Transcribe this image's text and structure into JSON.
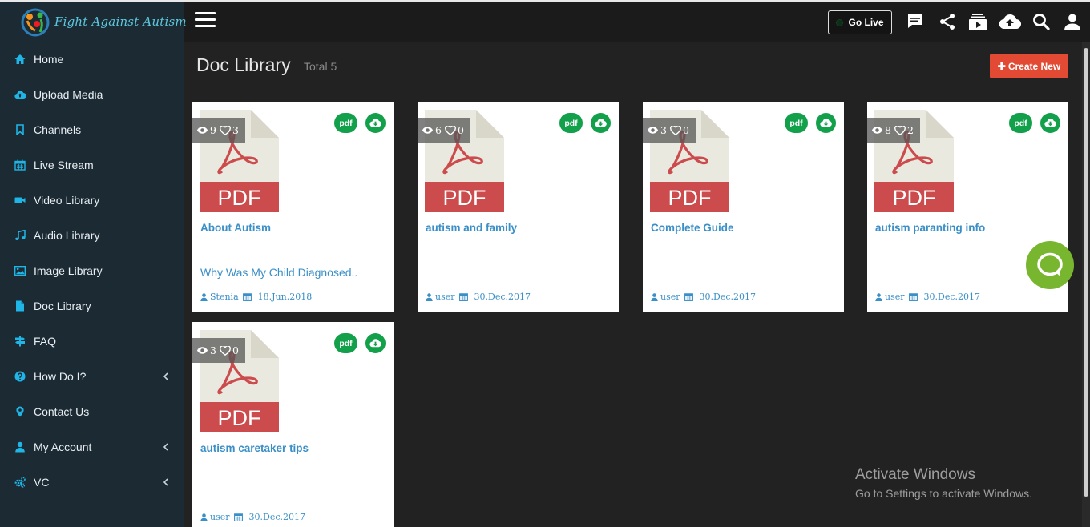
{
  "brand": {
    "name": "Fight Against Autism",
    "logo_icon": "autism-figures-logo"
  },
  "header": {
    "go_live_label": "Go Live",
    "icons": [
      "chat-icon",
      "share-icon",
      "playlist-icon",
      "upload-cloud-icon",
      "search-icon",
      "user-icon"
    ]
  },
  "sidebar": {
    "items": [
      {
        "label": "Home",
        "icon": "home-icon",
        "has_submenu": false
      },
      {
        "label": "Upload Media",
        "icon": "upload-cloud-icon",
        "has_submenu": false
      },
      {
        "label": "Channels",
        "icon": "bookmark-icon",
        "has_submenu": false
      },
      {
        "label": "Live Stream",
        "icon": "calendar-icon",
        "has_submenu": false
      },
      {
        "label": "Video Library",
        "icon": "video-camera-icon",
        "has_submenu": false
      },
      {
        "label": "Audio Library",
        "icon": "music-icon",
        "has_submenu": false
      },
      {
        "label": "Image Library",
        "icon": "image-icon",
        "has_submenu": false
      },
      {
        "label": "Doc Library",
        "icon": "file-icon",
        "has_submenu": false
      },
      {
        "label": "FAQ",
        "icon": "signpost-icon",
        "has_submenu": false
      },
      {
        "label": "How Do I?",
        "icon": "question-circle-icon",
        "has_submenu": true
      },
      {
        "label": "Contact Us",
        "icon": "map-marker-icon",
        "has_submenu": false
      },
      {
        "label": "My Account",
        "icon": "user-icon",
        "has_submenu": true
      },
      {
        "label": "VC",
        "icon": "cogs-icon",
        "has_submenu": true
      }
    ]
  },
  "main": {
    "title": "Doc Library",
    "total_label": "Total 5",
    "create_button_label": "Create New",
    "documents": [
      {
        "title": "About Autism",
        "description": "Why Was My Child Diagnosed..",
        "views": "9",
        "likes": "3",
        "author": "Stenia",
        "date": "18.Jun.2018",
        "format_badge": "pdf",
        "thumb_label": "PDF"
      },
      {
        "title": "autism and family",
        "description": "",
        "views": "6",
        "likes": "0",
        "author": "user",
        "date": "30.Dec.2017",
        "format_badge": "pdf",
        "thumb_label": "PDF"
      },
      {
        "title": "Complete Guide",
        "description": "",
        "views": "3",
        "likes": "0",
        "author": "user",
        "date": "30.Dec.2017",
        "format_badge": "pdf",
        "thumb_label": "PDF"
      },
      {
        "title": "autism paranting info",
        "description": "",
        "views": "8",
        "likes": "2",
        "author": "user",
        "date": "30.Dec.2017",
        "format_badge": "pdf",
        "thumb_label": "PDF"
      },
      {
        "title": "autism caretaker tips",
        "description": "",
        "views": "3",
        "likes": "0",
        "author": "user",
        "date": "30.Dec.2017",
        "format_badge": "pdf",
        "thumb_label": "PDF"
      }
    ]
  },
  "watermark": {
    "title": "Activate Windows",
    "subtitle": "Go to Settings to activate Windows."
  },
  "colors": {
    "sidebar_bg": "#1b2a33",
    "topbar_bg": "#1b1b1b",
    "main_bg": "#222222",
    "sidebar_icon": "#1fb5e6",
    "accent_red": "#e24a34",
    "badge_green": "#13a04b",
    "link_blue": "#3a8fc7",
    "chat_green": "#79b62f",
    "pdf_red": "#cc4b4c"
  }
}
